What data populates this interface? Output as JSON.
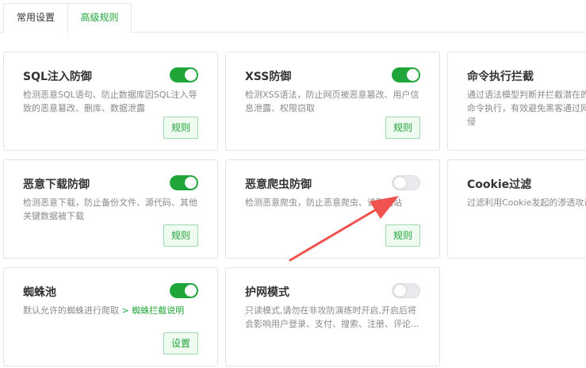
{
  "tabs": [
    {
      "label": "常用设置"
    },
    {
      "label": "高级规则"
    }
  ],
  "cards": [
    {
      "title": "SQL注入防御",
      "desc": "检测恶意SQL语句、防止数据库因SQL注入导致的恶意篡改、删库、数据泄露",
      "toggle": "on",
      "button": "规则"
    },
    {
      "title": "XSS防御",
      "desc": "检测XSS语法，防止网页被恶意篡改、用户信息泄露、权限窃取",
      "toggle": "on",
      "button": "规则"
    },
    {
      "title": "命令执行拦截",
      "desc": "通过语法模型判断并拦截潜在的恶意命令执行，有效避免黑客通过网站入侵"
    },
    {
      "title": "恶意下载防御",
      "desc": "检测恶意下载，防止备份文件、源代码、其他关键数据被下载",
      "toggle": "on",
      "button": "规则"
    },
    {
      "title": "恶意爬虫防御",
      "desc": "检测恶意爬虫，防止恶意爬虫、读取网站",
      "toggle": "off",
      "button": "规则"
    },
    {
      "title": "Cookie过滤",
      "desc": "过滤利用Cookie发起的渗透攻击"
    },
    {
      "title": "蜘蛛池",
      "desc": "默认允许的蜘蛛进行爬取 ",
      "desc_link": "> 蜘蛛拦截说明",
      "toggle": "on",
      "button": "设置"
    },
    {
      "title": "护网模式",
      "desc": "只读模式,请勿在非攻防演练时开启,开启后将会影响用户登录、支付、搜索、注册、评论...",
      "toggle": "off"
    }
  ],
  "colors": {
    "accent": "#20a53a",
    "arrow": "#f0524f"
  }
}
